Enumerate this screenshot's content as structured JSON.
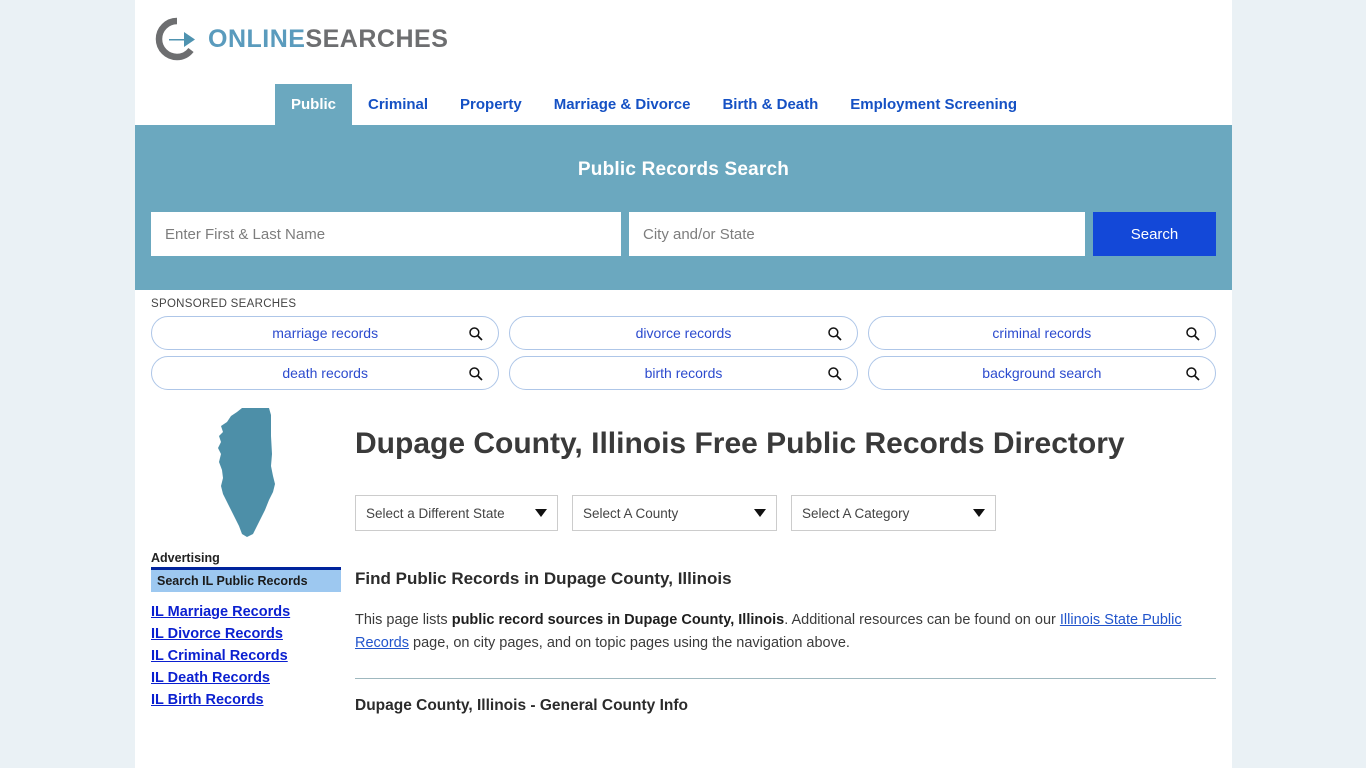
{
  "brand": {
    "logo_icon": "circle-arrow-icon",
    "name_part1": "ONLINE",
    "name_part2": "SEARCHES",
    "accent_blue": "#5a9bbd",
    "accent_gray": "#6d6e70"
  },
  "nav": {
    "tabs": [
      {
        "label": "Public",
        "active": true
      },
      {
        "label": "Criminal",
        "active": false
      },
      {
        "label": "Property",
        "active": false
      },
      {
        "label": "Marriage & Divorce",
        "active": false
      },
      {
        "label": "Birth & Death",
        "active": false
      },
      {
        "label": "Employment Screening",
        "active": false
      }
    ]
  },
  "search": {
    "title": "Public Records Search",
    "name_value": "",
    "name_placeholder": "Enter First & Last Name",
    "city_value": "",
    "city_placeholder": "City and/or State",
    "button_label": "Search",
    "band_color": "#6ba8bf",
    "button_color": "#1348d8"
  },
  "sponsored": {
    "label": "SPONSORED SEARCHES",
    "icon": "search-icon",
    "items": [
      {
        "label": "marriage records"
      },
      {
        "label": "divorce records"
      },
      {
        "label": "criminal records"
      },
      {
        "label": "death records"
      },
      {
        "label": "birth records"
      },
      {
        "label": "background search"
      }
    ]
  },
  "page": {
    "state_shape_icon": "illinois-state-outline-icon",
    "state_shape_color": "#4d8fa8",
    "title": "Dupage County, Illinois Free Public Records Directory"
  },
  "filters": [
    {
      "name": "state",
      "selected": "Select a Different State"
    },
    {
      "name": "county",
      "selected": "Select A County"
    },
    {
      "name": "category",
      "selected": "Select A Category"
    }
  ],
  "main": {
    "section_heading": "Find Public Records in Dupage County, Illinois",
    "intro_part1": "This page lists ",
    "intro_bold": "public record sources in Dupage County, Illinois",
    "intro_part2": ". Additional resources can be found on our ",
    "intro_link": "Illinois State Public Records",
    "intro_part3": " page, on city pages, and on topic pages using the navigation above.",
    "subsection_heading": "Dupage County, Illinois - General County Info"
  },
  "sidebar": {
    "advertising_label": "Advertising",
    "ad_heading": "Search IL Public Records",
    "ad_heading_bg": "#9dc8f0",
    "rule_color": "#00239c",
    "links": [
      {
        "label": "IL Marriage Records"
      },
      {
        "label": "IL Divorce Records"
      },
      {
        "label": "IL Criminal Records"
      },
      {
        "label": "IL Death Records"
      },
      {
        "label": "IL Birth Records"
      }
    ]
  }
}
